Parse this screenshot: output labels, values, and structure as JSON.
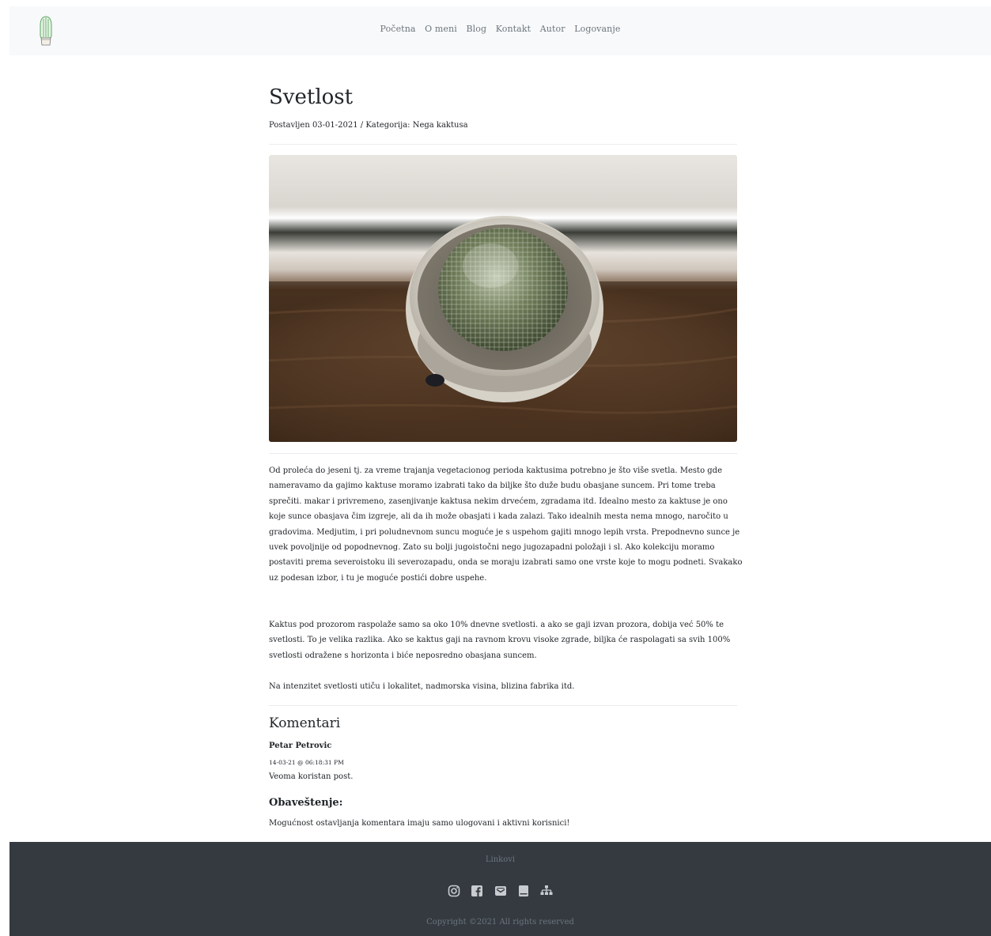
{
  "nav": {
    "logo_icon": "cactus-logo-icon",
    "links": [
      "Početna",
      "O meni",
      "Blog",
      "Kontakt",
      "Autor",
      "Logovanje"
    ]
  },
  "post": {
    "title": "Svetlost",
    "meta": "Postavljen 03-01-2021 / Kategorija: Nega kaktusa",
    "image": "cactus-in-pot-photo",
    "paragraphs": [
      "Od proleća do jeseni tj. za vreme trajanja vegetacionog perioda kaktusima potrebno je što više svetla. Mesto gde nameravamo da gajimo kaktuse moramo izabrati tako da biljke što duže budu obasjane suncem. Pri tome treba sprečiti. makar i privremeno, zasenjivanje kaktusa nekim drvećem, zgradama itd. Idealno mesto za kaktuse je ono koje sunce obasjava čim izgreje, ali da ih može obasjati i kada zalazi. Tako idealnih mesta nema mnogo, naročito u gradovima. Medjutim, i pri poludnevnom suncu moguće je s uspehom gajiti mnogo lepih vrsta. Prepodnevno sunce je uvek povoljnije od popodnevnog. Zato su bolji jugoistočni nego jugozapadni položaji i sl. Ako kolekciju moramo postaviti prema severoistoku ili severozapadu, onda se moraju izabrati samo one vrste koje to mogu podneti. Svakako uz podesan izbor, i tu je moguće postići dobre uspehe.",
      "Kaktus pod prozorom raspolaže samo sa oko 10% dnevne svetlosti. a ako se gaji izvan prozora, dobija već 50% te svetlosti. To je velika razlika. Ako se kaktus gaji na ravnom krovu visoke zgrade, biljka će raspolagati sa svih 100% svetlosti odražene s horizonta i biće neposredno obasjana suncem.",
      "Na intenzitet svetlosti utiču i lokalitet, nadmorska visina, blizina fabrika itd."
    ]
  },
  "comments": {
    "title": "Komentari",
    "items": [
      {
        "author": "Petar Petrovic",
        "date": "14-03-21 @ 06:18:31 PM",
        "text": "Veoma koristan post."
      }
    ]
  },
  "notice": {
    "title": "Obaveštenje:",
    "text": "Mogućnost ostavljanja komentara imaju samo ulogovani i aktivni korisnici!"
  },
  "footer": {
    "links_label": "Linkovi",
    "icons": [
      "instagram-icon",
      "facebook-icon",
      "envelope-icon",
      "book-icon",
      "sitemap-icon"
    ],
    "copyright": "Copyright ©2021 All rights reserved"
  },
  "colors": {
    "navbar_bg": "#f8f9fa",
    "footer_bg": "#343a40",
    "muted_text": "#6c757d",
    "logo_green": "#6fbf73"
  }
}
